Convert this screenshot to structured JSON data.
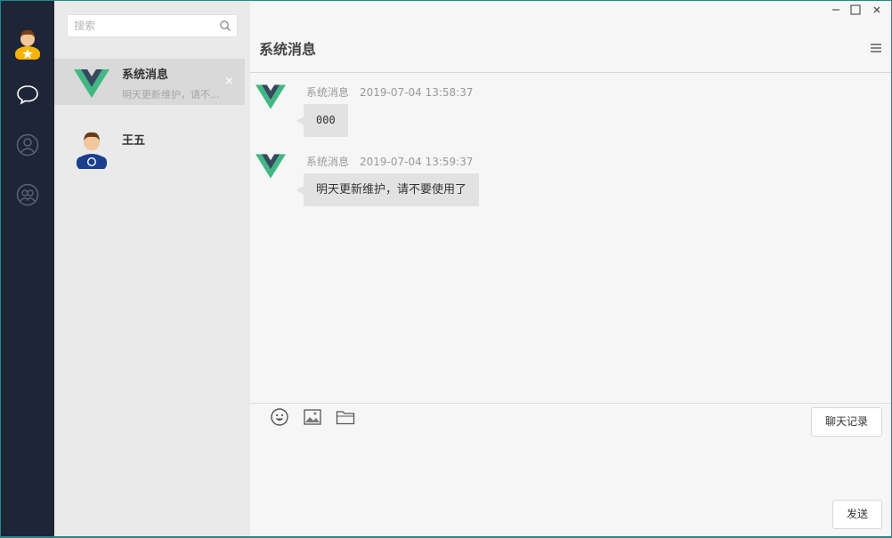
{
  "search": {
    "placeholder": "搜索"
  },
  "sessions": [
    {
      "name": "系统消息",
      "preview": "明天更新维护，请不...",
      "close": "×"
    },
    {
      "name": "王五"
    }
  ],
  "chat": {
    "title": "系统消息",
    "messages": [
      {
        "sender": "系统消息",
        "time": "2019-07-04 13:58:37",
        "text": "000"
      },
      {
        "sender": "系统消息",
        "time": "2019-07-04 13:59:37",
        "text": "明天更新维护，请不要使用了"
      }
    ],
    "history_label": "聊天记录",
    "send_label": "发送"
  },
  "colors": {
    "rail_bg": "#1e2536",
    "session_bg": "#eaeaea",
    "active_session": "#d9d9d9",
    "chat_bg": "#f6f6f6",
    "bubble_bg": "#e2e2e2",
    "vue_green": "#41b883",
    "vue_dark": "#35495e"
  },
  "icons": {
    "rail": [
      "user-avatar",
      "chat-bubble-icon",
      "contact-icon",
      "group-icon"
    ],
    "toolbar": [
      "emoji-icon",
      "image-icon",
      "folder-icon"
    ],
    "window": [
      "minimize-icon",
      "maximize-icon",
      "close-icon"
    ]
  }
}
